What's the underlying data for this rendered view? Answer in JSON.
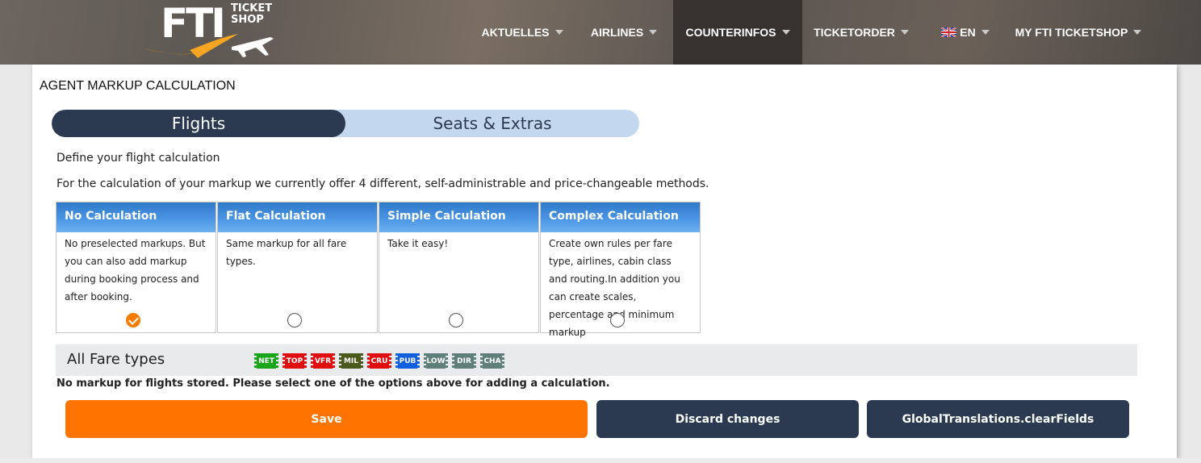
{
  "header": {
    "logo": {
      "main": "FTI",
      "sub_line1": "TICKET",
      "sub_line2": "SHOP"
    },
    "nav": [
      {
        "label": "AKTUELLES",
        "has_caret": true,
        "active": false
      },
      {
        "label": "AIRLINES",
        "has_caret": true,
        "active": false
      },
      {
        "label": "COUNTERINFOS",
        "has_caret": true,
        "active": true
      },
      {
        "label": "TICKETORDER",
        "has_caret": true,
        "active": false
      },
      {
        "label": "EN",
        "has_caret": true,
        "active": false,
        "icon": "uk-flag-icon"
      },
      {
        "label": "MY FTI TICKETSHOP",
        "has_caret": true,
        "active": false
      }
    ]
  },
  "page": {
    "heading": "AGENT MARKUP CALCULATION",
    "tabs": [
      {
        "label": "Flights",
        "active": true
      },
      {
        "label": "Seats & Extras",
        "active": false
      }
    ],
    "intro_title": "Define your flight calculation",
    "intro_text": "For the calculation of your markup we currently offer 4 different, self-administrable and price-changeable methods.",
    "calc_options": [
      {
        "title": "No Calculation",
        "description": "No preselected markups. But you can also add markup during booking process and after booking.",
        "selected": true
      },
      {
        "title": "Flat Calculation",
        "description": "Same markup for all fare types.",
        "selected": false
      },
      {
        "title": "Simple Calculation",
        "description": "Take it easy!",
        "selected": false
      },
      {
        "title": "Complex Calculation",
        "description": "Create own rules per fare type, airlines, cabin class and routing.In addition you can create scales, percentage and minimum markup",
        "selected": false
      }
    ],
    "fare_types": {
      "label": "All Fare types",
      "badges": [
        {
          "code": "NET",
          "color": "#1aa51a"
        },
        {
          "code": "TOP",
          "color": "#e01010"
        },
        {
          "code": "VFR",
          "color": "#e01010"
        },
        {
          "code": "MIL",
          "color": "#4a5a1c"
        },
        {
          "code": "CRU",
          "color": "#e01010"
        },
        {
          "code": "PUB",
          "color": "#1060e0"
        },
        {
          "code": "LOW",
          "color": "#5f7f7a"
        },
        {
          "code": "DIR",
          "color": "#5f7f7a"
        },
        {
          "code": "CHA",
          "color": "#5f7f7a"
        }
      ]
    },
    "no_markup_note": "No markup for flights stored. Please select one of the options above for adding a calculation.",
    "buttons": {
      "save": "Save",
      "discard": "Discard changes",
      "clear": "GlobalTranslations.clearFields"
    }
  },
  "colors": {
    "accent_orange": "#ff7300",
    "dark_navy": "#2b3a50",
    "tab_inactive": "#c3d8ef",
    "card_header_blue": "#3d8ad8"
  }
}
